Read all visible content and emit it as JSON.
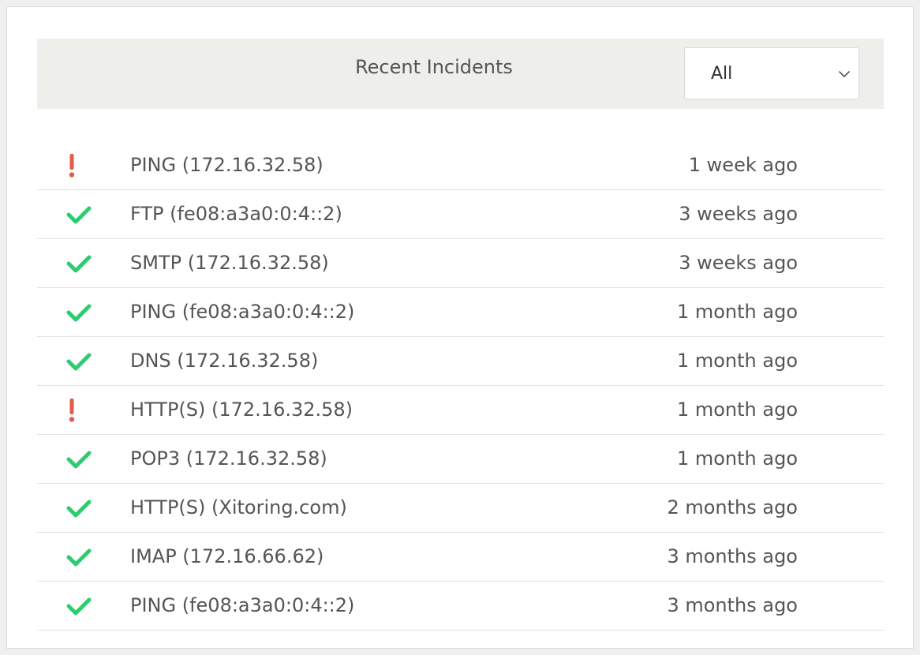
{
  "colors": {
    "success": "#2ecc71",
    "alert": "#e05d4b",
    "header_bg": "#eeeeea",
    "text": "#555555"
  },
  "incidents_panel": {
    "title": "Recent Incidents",
    "filter": {
      "selected": "All",
      "icon": "chevron-down-icon"
    },
    "rows": [
      {
        "status": "alert",
        "icon": "exclamation-icon",
        "name": "PING (172.16.32.58)",
        "time": "1 week ago"
      },
      {
        "status": "ok",
        "icon": "checkmark-icon",
        "name": "FTP (fe08:a3a0:0:4::2)",
        "time": "3 weeks ago"
      },
      {
        "status": "ok",
        "icon": "checkmark-icon",
        "name": "SMTP (172.16.32.58)",
        "time": "3 weeks ago"
      },
      {
        "status": "ok",
        "icon": "checkmark-icon",
        "name": "PING (fe08:a3a0:0:4::2)",
        "time": "1 month ago"
      },
      {
        "status": "ok",
        "icon": "checkmark-icon",
        "name": "DNS (172.16.32.58)",
        "time": "1 month ago"
      },
      {
        "status": "alert",
        "icon": "exclamation-icon",
        "name": "HTTP(S) (172.16.32.58)",
        "time": "1 month ago"
      },
      {
        "status": "ok",
        "icon": "checkmark-icon",
        "name": "POP3 (172.16.32.58)",
        "time": "1 month ago"
      },
      {
        "status": "ok",
        "icon": "checkmark-icon",
        "name": "HTTP(S) (Xitoring.com)",
        "time": "2 months ago"
      },
      {
        "status": "ok",
        "icon": "checkmark-icon",
        "name": "IMAP (172.16.66.62)",
        "time": "3 months ago"
      },
      {
        "status": "ok",
        "icon": "checkmark-icon",
        "name": "PING (fe08:a3a0:0:4::2)",
        "time": "3 months ago"
      }
    ]
  }
}
